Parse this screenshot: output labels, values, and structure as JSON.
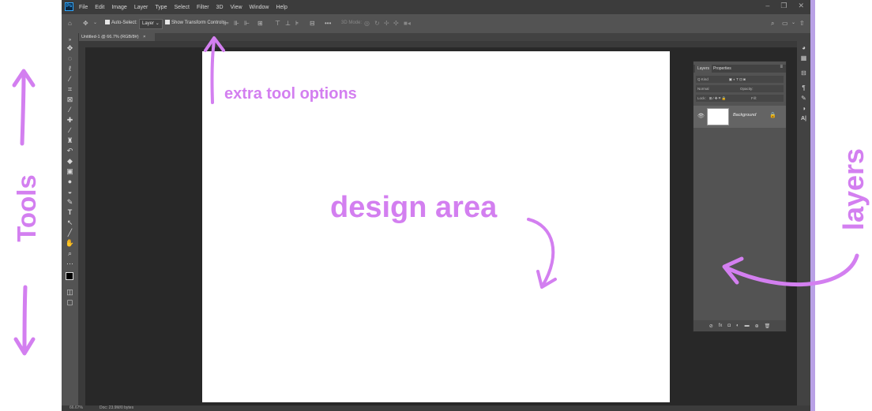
{
  "app": {
    "logo": "Ps"
  },
  "menu": [
    "File",
    "Edit",
    "Image",
    "Layer",
    "Type",
    "Select",
    "Filter",
    "3D",
    "View",
    "Window",
    "Help"
  ],
  "options": {
    "auto_select": "Auto-Select:",
    "layer_dropdown": "Layer",
    "show_transform": "Show Transform Controls",
    "mode_label": "3D Mode:"
  },
  "document": {
    "tab_label": "Untitled-1 @ 66.7% (RGB/8#)",
    "tab_close": "×"
  },
  "status": {
    "zoom": "66.67%",
    "doc_size": "Doc: 23.9M/0 bytes"
  },
  "layers_panel": {
    "tabs": [
      "Layers",
      "Properties"
    ],
    "kind_label": "Q Kind",
    "blend_mode": "Normal",
    "opacity_label": "Opacity:",
    "lock_label": "Lock:",
    "fill_label": "Fill:",
    "layer_name": "Background"
  },
  "annotations": {
    "tools": "Tools",
    "extra_tool_options": "extra tool options",
    "design_area": "design area",
    "layers": "layers"
  },
  "colors": {
    "annotation": "#d37ff0",
    "ps_dark": "#535353",
    "canvas": "#ffffff"
  },
  "icons": [
    "move-icon",
    "marquee-icon",
    "lasso-icon",
    "magic-wand-icon",
    "crop-icon",
    "frame-icon",
    "eyedropper-icon",
    "healing-icon",
    "brush-icon",
    "stamp-icon",
    "history-brush-icon",
    "eraser-icon",
    "gradient-icon",
    "blur-icon",
    "dodge-icon",
    "pen-icon",
    "type-icon",
    "path-select-icon",
    "line-icon",
    "hand-icon",
    "zoom-icon",
    "more-icon",
    "colors-icon",
    "quick-mask-icon",
    "screen-mode-icon"
  ]
}
